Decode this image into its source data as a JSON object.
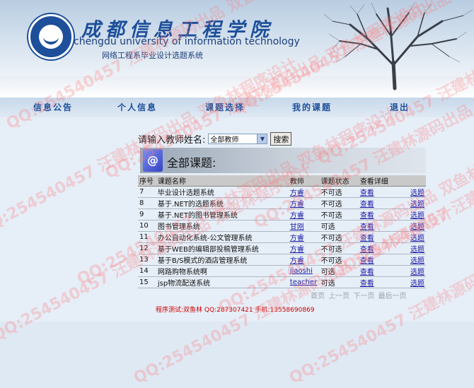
{
  "header": {
    "title_cn": "成都信息工程学院",
    "title_en": "chengdu university of information technology",
    "subtitle": "网络工程系毕业设计选题系统"
  },
  "nav": [
    "信息公告",
    "个人信息",
    "课题选择",
    "我的课题",
    "退出"
  ],
  "search": {
    "label": "请输入教师姓名:",
    "selected": "全部教师",
    "button": "搜索"
  },
  "section": {
    "title": "全部课题:"
  },
  "table": {
    "headers": [
      "序号",
      "课题名称",
      "教师",
      "课题状态",
      "查看详细"
    ],
    "rows": [
      {
        "no": "7",
        "name": "毕业设计选题系统",
        "teacher": "方睿",
        "status": "不可选",
        "detail": "查看",
        "action": "选题"
      },
      {
        "no": "8",
        "name": "基于.NET的选题系统",
        "teacher": "方睿",
        "status": "不可选",
        "detail": "查看",
        "action": "选题"
      },
      {
        "no": "9",
        "name": "基于.NET的图书管理系统",
        "teacher": "方睿",
        "status": "不可选",
        "detail": "查看",
        "action": "选题"
      },
      {
        "no": "10",
        "name": "图书管理系统",
        "teacher": "甘刚",
        "status": "可选",
        "detail": "查看",
        "action": "选题"
      },
      {
        "no": "11",
        "name": "办公自动化系统-公文管理系统",
        "teacher": "方睿",
        "status": "不可选",
        "detail": "查看",
        "action": "选题"
      },
      {
        "no": "12",
        "name": "基于WEB的编辑部投稿管理系统",
        "teacher": "方睿",
        "status": "不可选",
        "detail": "查看",
        "action": "选题"
      },
      {
        "no": "13",
        "name": "基于B/S模式的酒店管理系统",
        "teacher": "方睿",
        "status": "不可选",
        "detail": "查看",
        "action": "选题"
      },
      {
        "no": "14",
        "name": "网路购物系统啊",
        "teacher": "jiaoshi",
        "status": "可选",
        "detail": "查看",
        "action": "选题"
      },
      {
        "no": "15",
        "name": "jsp物流配送系统",
        "teacher": "teacher",
        "status": "可选",
        "detail": "查看",
        "action": "选题"
      }
    ]
  },
  "pager": {
    "first": "首页",
    "prev": "上一页",
    "next": "下一页",
    "last": "最后一页"
  },
  "footer": "程序测试:双鱼林 QQ:287307421 手机:13558690869",
  "watermark": "QQ:254540457 汪建林源码出品 双鱼林程序设计",
  "colors": {
    "brand": "#1d4f9a",
    "link": "#1a1aa6",
    "footer": "#cc0000"
  }
}
